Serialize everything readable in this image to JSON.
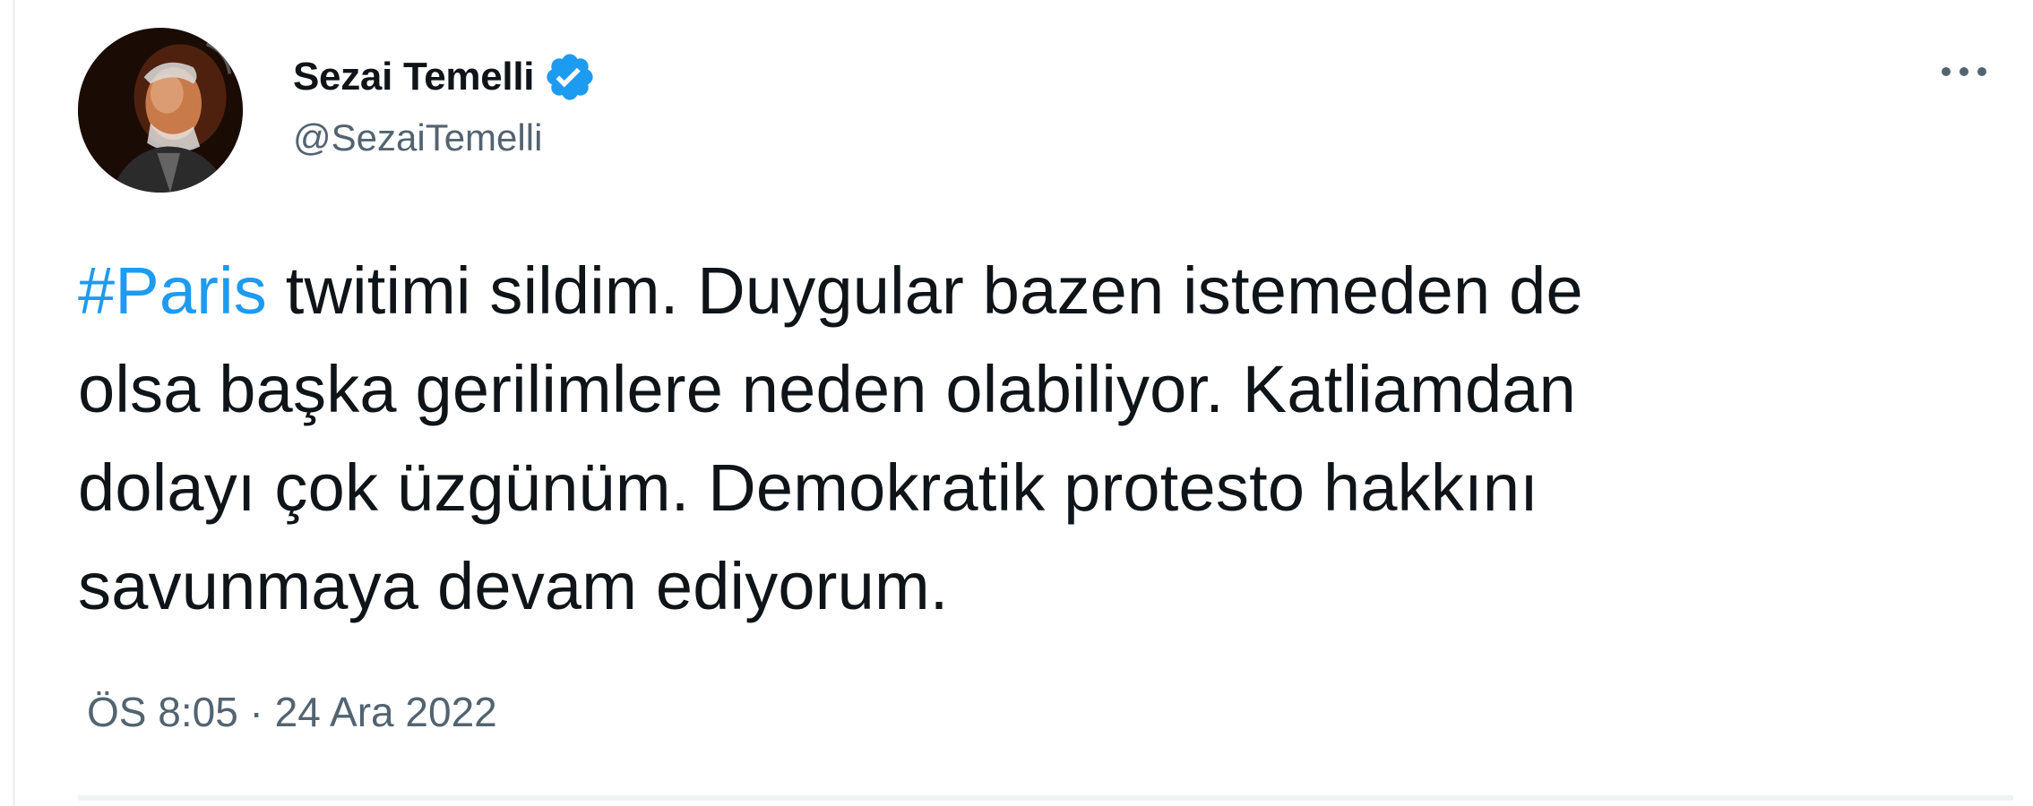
{
  "author": {
    "display_name": "Sezai Temelli",
    "handle": "@SezaiTemelli",
    "verified_icon": "verified-badge-icon",
    "avatar_icon": "avatar"
  },
  "tweet": {
    "hashtag": "#Paris",
    "text_lines": [
      " twitimi sildim. Duygular bazen istemeden de",
      "olsa başka gerilimlere neden olabiliyor. Katliamdan",
      "dolayı çok üzgünüm. Demokratik protesto hakkını",
      "savunmaya devam ediyorum."
    ],
    "timestamp": "ÖS 8:05 · 24 Ara 2022"
  },
  "colors": {
    "accent": "#1d9bf0",
    "text": "#0f1419",
    "muted": "#536471",
    "border": "#eff3f4"
  },
  "icons": {
    "more": "more-dots-icon"
  }
}
